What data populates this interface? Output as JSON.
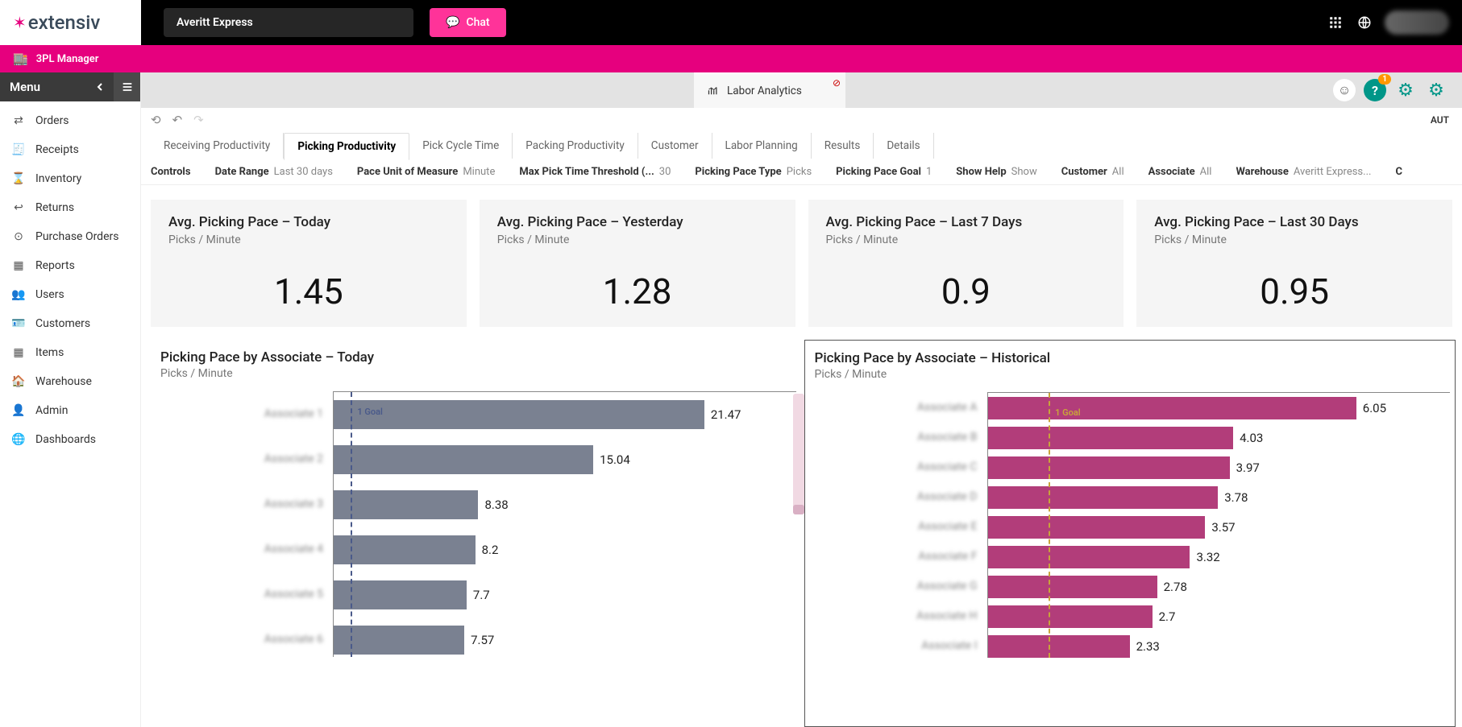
{
  "logo_text": "extensiv",
  "customer_selector": "Averitt Express",
  "chat_label": "Chat",
  "secondary_bar_label": "3PL Manager",
  "menu_title": "Menu",
  "help_badge": "1",
  "sidebar": {
    "items": [
      {
        "label": "Orders"
      },
      {
        "label": "Receipts"
      },
      {
        "label": "Inventory"
      },
      {
        "label": "Returns"
      },
      {
        "label": "Purchase Orders"
      },
      {
        "label": "Reports"
      },
      {
        "label": "Users"
      },
      {
        "label": "Customers"
      },
      {
        "label": "Items"
      },
      {
        "label": "Warehouse"
      },
      {
        "label": "Admin"
      },
      {
        "label": "Dashboards"
      }
    ]
  },
  "tab": {
    "label": "Labor Analytics"
  },
  "aut_label": "AUT",
  "report_tabs": [
    "Receiving Productivity",
    "Picking Productivity",
    "Pick Cycle Time",
    "Packing Productivity",
    "Customer",
    "Labor Planning",
    "Results",
    "Details"
  ],
  "active_report_tab": "Picking Productivity",
  "controls": {
    "title": "Controls",
    "items": [
      {
        "k": "Date Range",
        "v": "Last 30 days"
      },
      {
        "k": "Pace Unit of Measure",
        "v": "Minute"
      },
      {
        "k": "Max Pick Time Threshold (...",
        "v": "30"
      },
      {
        "k": "Picking Pace Type",
        "v": "Picks"
      },
      {
        "k": "Picking Pace Goal",
        "v": "1"
      },
      {
        "k": "Show Help",
        "v": "Show"
      },
      {
        "k": "Customer",
        "v": "All"
      },
      {
        "k": "Associate",
        "v": "All"
      },
      {
        "k": "Warehouse",
        "v": "Averitt Express..."
      }
    ],
    "trailing": "C"
  },
  "cards": [
    {
      "title": "Avg. Picking Pace – Today",
      "sub": "Picks / Minute",
      "value": "1.45"
    },
    {
      "title": "Avg. Picking Pace – Yesterday",
      "sub": "Picks / Minute",
      "value": "1.28"
    },
    {
      "title": "Avg. Picking Pace – Last 7 Days",
      "sub": "Picks / Minute",
      "value": "0.9"
    },
    {
      "title": "Avg. Picking Pace – Last 30 Days",
      "sub": "Picks / Minute",
      "value": "0.95"
    }
  ],
  "charts": {
    "left": {
      "title": "Picking Pace by Associate – Today",
      "sub": "Picks / Minute",
      "goal_label": "1 Goal"
    },
    "right": {
      "title": "Picking Pace by Associate – Historical",
      "sub": "Picks / Minute",
      "goal_label": "1 Goal"
    }
  },
  "chart_data": [
    {
      "type": "bar",
      "orientation": "horizontal",
      "title": "Picking Pace by Associate – Today",
      "xlabel": "Picks / Minute",
      "categories": [
        "Associate 1",
        "Associate 2",
        "Associate 3",
        "Associate 4",
        "Associate 5",
        "Associate 6"
      ],
      "values": [
        21.47,
        15.04,
        8.38,
        8.2,
        7.7,
        7.57
      ],
      "goal_line": 1,
      "bar_color": "#7a8191"
    },
    {
      "type": "bar",
      "orientation": "horizontal",
      "title": "Picking Pace by Associate – Historical",
      "xlabel": "Picks / Minute",
      "categories": [
        "Associate A",
        "Associate B",
        "Associate C",
        "Associate D",
        "Associate E",
        "Associate F",
        "Associate G",
        "Associate H",
        "Associate I"
      ],
      "values": [
        6.05,
        4.03,
        3.97,
        3.78,
        3.57,
        3.32,
        2.78,
        2.7,
        2.33
      ],
      "goal_line": 1,
      "bar_color": "#b23d7a"
    }
  ]
}
